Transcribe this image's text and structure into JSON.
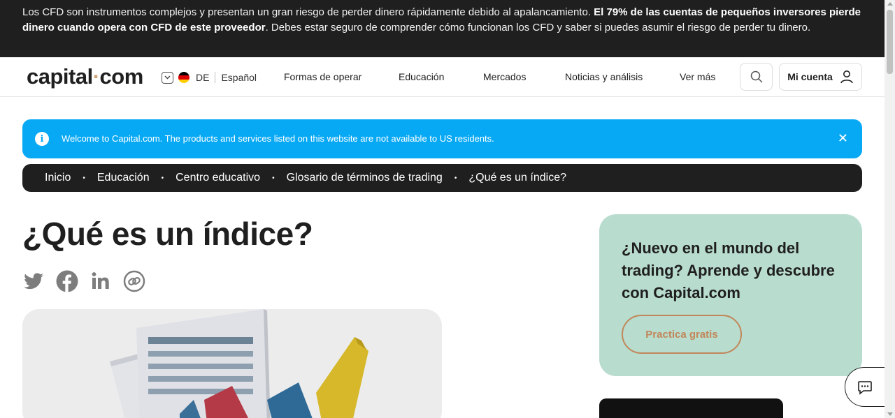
{
  "risk_warning": {
    "text_before": "Los CFD son instrumentos complejos y presentan un gran riesgo de perder dinero rápidamente debido al apalancamiento. ",
    "text_bold": "El 79% de las cuentas de pequeños inversores pierde dinero cuando opera con CFD de este proveedor",
    "text_after": ". Debes estar seguro de comprender cómo funcionan los CFD y saber si puedes asumir el riesgo de perder tu dinero."
  },
  "header": {
    "logo_left": "capital",
    "logo_dot": "·",
    "logo_right": "com",
    "country_code": "DE",
    "language": "Español",
    "nav": [
      "Formas de operar",
      "Educación",
      "Mercados",
      "Noticias y análisis",
      "Ver más"
    ],
    "account_label": "Mi cuenta"
  },
  "notice": {
    "info_icon": "i",
    "message": "Welcome to Capital.com. The products and services listed on this website are not available to US residents.",
    "close_icon": "✕"
  },
  "breadcrumb": [
    "Inicio",
    "Educación",
    "Centro educativo",
    "Glosario de términos de trading",
    "¿Qué es un índice?"
  ],
  "breadcrumb_separator": "•",
  "page_title": "¿Qué es un índice?",
  "social": [
    "twitter-icon",
    "facebook-icon",
    "linkedin-icon",
    "copy-link-icon"
  ],
  "promo": {
    "title": "¿Nuevo en el mundo del trading? Aprende y descubre con Capital.com",
    "cta": "Practica gratis"
  },
  "colors": {
    "dark": "#1f1f1f",
    "notice_blue": "#07a9f5",
    "promo_green": "#b8dccd",
    "accent_copper": "#c1875a",
    "logo_dot": "#d0a278"
  }
}
